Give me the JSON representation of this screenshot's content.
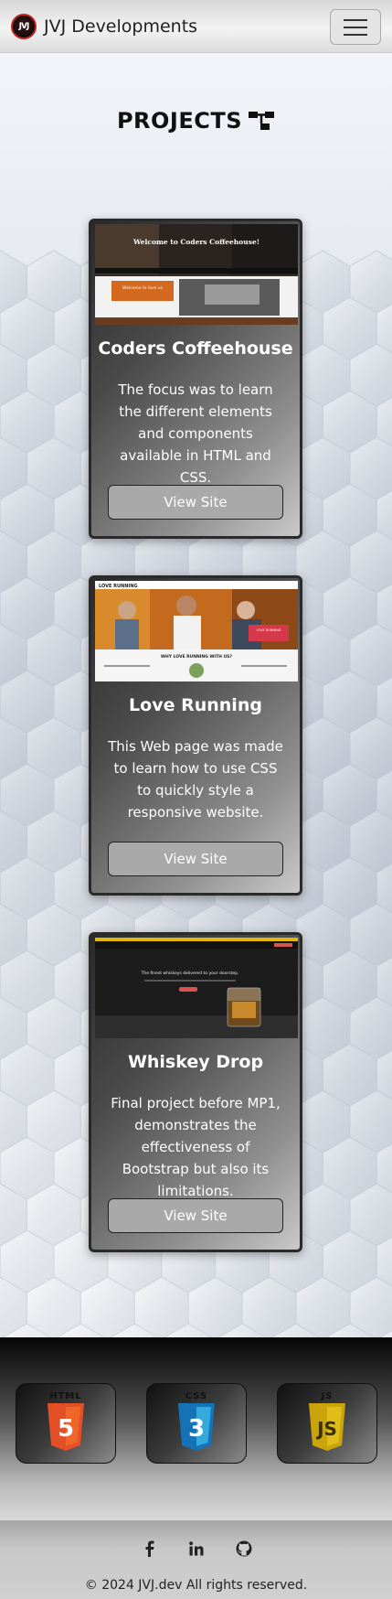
{
  "navbar": {
    "logo_text": "JVJ",
    "brand": "JVJ Developments",
    "menu_icon": "hamburger-icon"
  },
  "projects_section": {
    "title": "PROJECTS",
    "title_icon": "sitemap-icon"
  },
  "projects": [
    {
      "title": "Coders Coffeehouse",
      "description": "The focus was to learn the different elements and components available in HTML and CSS.",
      "button": "View Site",
      "screenshot": {
        "hero_text": "Welcome to Coders Coffeehouse!",
        "panel_text": "Welcome to love us"
      }
    },
    {
      "title": "Love Running",
      "description": "This Web page was made to learn how to use CSS to quickly style a responsive website.",
      "button": "View Site",
      "screenshot": {
        "logo_text": "LOVE RUNNING",
        "banner_text": "WHY LOVE RUNNING WITH US?",
        "badge_text": "LOVE RUNNING"
      }
    },
    {
      "title": "Whiskey Drop",
      "description": "Final project before MP1, demonstrates the effectiveness of Bootstrap but also its limitations.",
      "button": "View Site",
      "screenshot": {
        "headline": "The finest whiskeys delivered to your doorstep."
      }
    }
  ],
  "tech_stack": [
    {
      "label": "HTML",
      "digit": "5",
      "color": "#e34f26",
      "icon": "html5-icon"
    },
    {
      "label": "CSS",
      "digit": "3",
      "color": "#1572b6",
      "icon": "css3-icon"
    },
    {
      "label": "JS",
      "digit": "JS",
      "color": "#d4b106",
      "icon": "javascript-icon"
    }
  ],
  "footer": {
    "socials": [
      "facebook-icon",
      "linkedin-icon",
      "github-icon"
    ],
    "copyright": "© 2024 JVJ.dev All rights reserved."
  }
}
